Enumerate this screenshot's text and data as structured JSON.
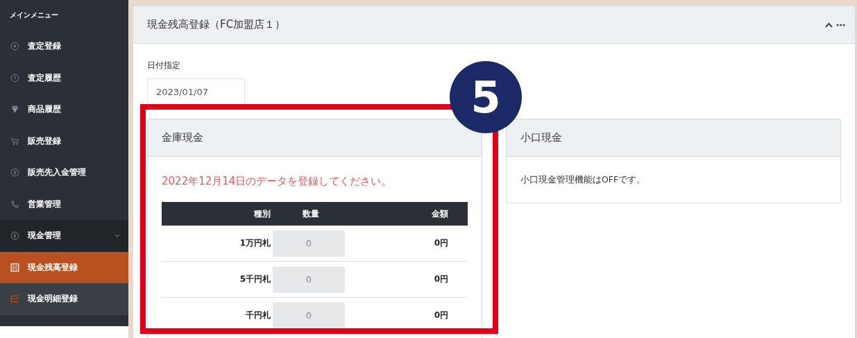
{
  "sidebar": {
    "heading": "メインメニュー",
    "items": [
      {
        "label": "査定登録",
        "kind": "plus",
        "selected": false
      },
      {
        "label": "査定履歴",
        "kind": "clock",
        "selected": false
      },
      {
        "label": "商品履歴",
        "kind": "diamond",
        "selected": false
      },
      {
        "label": "販売登録",
        "kind": "cart",
        "selected": false
      },
      {
        "label": "販売先入金管理",
        "kind": "yen",
        "selected": false
      },
      {
        "label": "営業管理",
        "kind": "phone",
        "selected": false
      },
      {
        "label": "現金管理",
        "kind": "yen",
        "selected": false,
        "expanded": true,
        "children": [
          {
            "label": "現金残高登録",
            "kind": "grid",
            "selected": true
          },
          {
            "label": "現金明細登録",
            "kind": "list",
            "selected": false
          }
        ]
      }
    ]
  },
  "panel": {
    "title": "現金残高登録（FC加盟店１）",
    "date_label": "日付指定",
    "date_value": "2023/01/07",
    "safe_card": {
      "title": "金庫現金",
      "notice": "2022年12月14日のデータを登録してください。",
      "columns": [
        "種別",
        "数量",
        "金額"
      ],
      "rows": [
        {
          "type": "1万円札",
          "quantity_placeholder": "0",
          "amount": "0円"
        },
        {
          "type": "5千円札",
          "quantity_placeholder": "0",
          "amount": "0円"
        },
        {
          "type": "千円札",
          "quantity_placeholder": "0",
          "amount": "0円"
        }
      ]
    },
    "petty_card": {
      "title": "小口現金",
      "message": "小口現金管理機能はOFFです。"
    }
  },
  "annotation": {
    "badge": "5"
  }
}
